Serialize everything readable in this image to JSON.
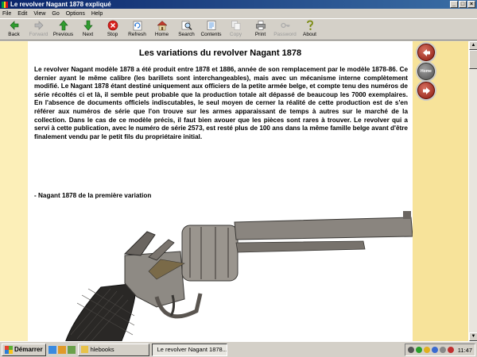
{
  "window": {
    "title": "Le revolver Nagant 1878 expliqué"
  },
  "menu": [
    "File",
    "Edit",
    "View",
    "Go",
    "Options",
    "Help"
  ],
  "toolbar": [
    {
      "label": "Back",
      "icon": "back-arrow-icon",
      "enabled": true
    },
    {
      "label": "Forward",
      "icon": "forward-arrow-icon",
      "enabled": false
    },
    {
      "label": "Previous",
      "icon": "up-arrow-icon",
      "enabled": true
    },
    {
      "label": "Next",
      "icon": "down-arrow-icon",
      "enabled": true
    },
    {
      "label": "Stop",
      "icon": "stop-icon",
      "enabled": true
    },
    {
      "label": "Refresh",
      "icon": "refresh-icon",
      "enabled": true
    },
    {
      "label": "Home",
      "icon": "home-icon",
      "enabled": true
    },
    {
      "label": "Search",
      "icon": "search-icon",
      "enabled": true
    },
    {
      "label": "Contents",
      "icon": "contents-icon",
      "enabled": true
    },
    {
      "label": "Copy",
      "icon": "copy-icon",
      "enabled": false
    },
    {
      "label": "Print",
      "icon": "print-icon",
      "enabled": true
    },
    {
      "label": "Password",
      "icon": "password-icon",
      "enabled": false
    },
    {
      "label": "About",
      "icon": "about-icon",
      "enabled": true
    }
  ],
  "page": {
    "title": "Les variations du revolver Nagant 1878",
    "body": "Le revolver Nagant modèle 1878 a été produit entre 1878 et 1886, année de son remplacement par le modèle 1878-86. Ce dernier ayant le même calibre (les barillets sont interchangeables), mais avec un mécanisme interne complètement modifié. Le Nagant 1878 étant destiné uniquement aux officiers de la petite armée belge, et compte tenu des numéros de série récoltés ci et là, il semble peut probable que la production totale ait dépassé de beaucoup les 7000 exemplaires. En l'absence de documents officiels indiscutables, le seul moyen de cerner la réalité de cette production est de s'en référer aux numéros de série que l'on trouve sur les armes apparaissant de temps à autres sur le marché de la collection. Dans le cas de ce modèle précis, il faut bien avouer que les pièces sont rares à trouver. Le revolver qui a servi à cette publication, avec le numéro de série 2573, est resté plus de 100 ans dans la même famille belge avant d'être finalement vendu par le petit fils du propriétaire initial.",
    "subheading": "- Nagant 1878 de la première variation"
  },
  "side_nav": {
    "home_label": "Home"
  },
  "taskbar": {
    "start_label": "Démarrer",
    "tasks": [
      {
        "label": "hlebooks",
        "active": false
      },
      {
        "label": "Le revolver Nagant 1878...",
        "active": true
      }
    ],
    "clock": "11:47"
  },
  "colors": {
    "content_bg": "#fcefb8",
    "rail_bg": "#f7e39a",
    "nav_button": "#a8251a",
    "titlebar": "#0a246a"
  }
}
